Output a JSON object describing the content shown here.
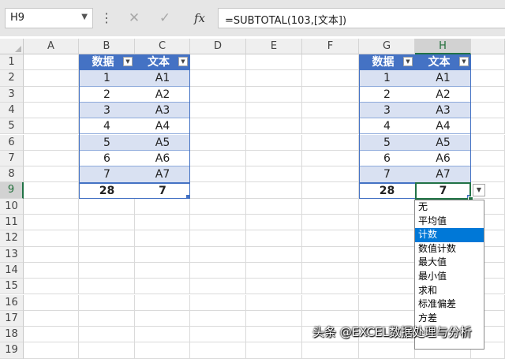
{
  "formula_bar": {
    "name_box": "H9",
    "formula": "=SUBTOTAL(103,[文本])",
    "fx_label": "fx",
    "cancel_icon": "✕",
    "enter_icon": "✓"
  },
  "columns": [
    "A",
    "B",
    "C",
    "D",
    "E",
    "F",
    "G",
    "H"
  ],
  "rows": [
    "1",
    "2",
    "3",
    "4",
    "5",
    "6",
    "7",
    "8",
    "9",
    "10",
    "11",
    "12",
    "13",
    "14",
    "15",
    "16",
    "17",
    "18",
    "19"
  ],
  "selected_column": "H",
  "selected_row": "9",
  "table_left": {
    "header_data": "数据",
    "header_text": "文本",
    "rows": [
      {
        "data": "1",
        "text": "A1"
      },
      {
        "data": "2",
        "text": "A2"
      },
      {
        "data": "3",
        "text": "A3"
      },
      {
        "data": "4",
        "text": "A4"
      },
      {
        "data": "5",
        "text": "A5"
      },
      {
        "data": "6",
        "text": "A6"
      },
      {
        "data": "7",
        "text": "A7"
      }
    ],
    "total_data": "28",
    "total_text": "7"
  },
  "table_right": {
    "header_data": "数据",
    "header_text": "文本",
    "rows": [
      {
        "data": "1",
        "text": "A1"
      },
      {
        "data": "2",
        "text": "A2"
      },
      {
        "data": "3",
        "text": "A3"
      },
      {
        "data": "4",
        "text": "A4"
      },
      {
        "data": "5",
        "text": "A5"
      },
      {
        "data": "6",
        "text": "A6"
      },
      {
        "data": "7",
        "text": "A7"
      }
    ],
    "total_data": "28",
    "total_text": "7"
  },
  "total_dropdown": {
    "options": [
      "无",
      "平均值",
      "计数",
      "数值计数",
      "最大值",
      "最小值",
      "求和",
      "标准偏差",
      "方差"
    ],
    "selected": "计数"
  },
  "watermark": "头条 @EXCEL数据处理与分析",
  "colors": {
    "table_header": "#4472c4",
    "band": "#d9e1f2",
    "selection": "#217346",
    "menu_highlight": "#0078d7"
  }
}
